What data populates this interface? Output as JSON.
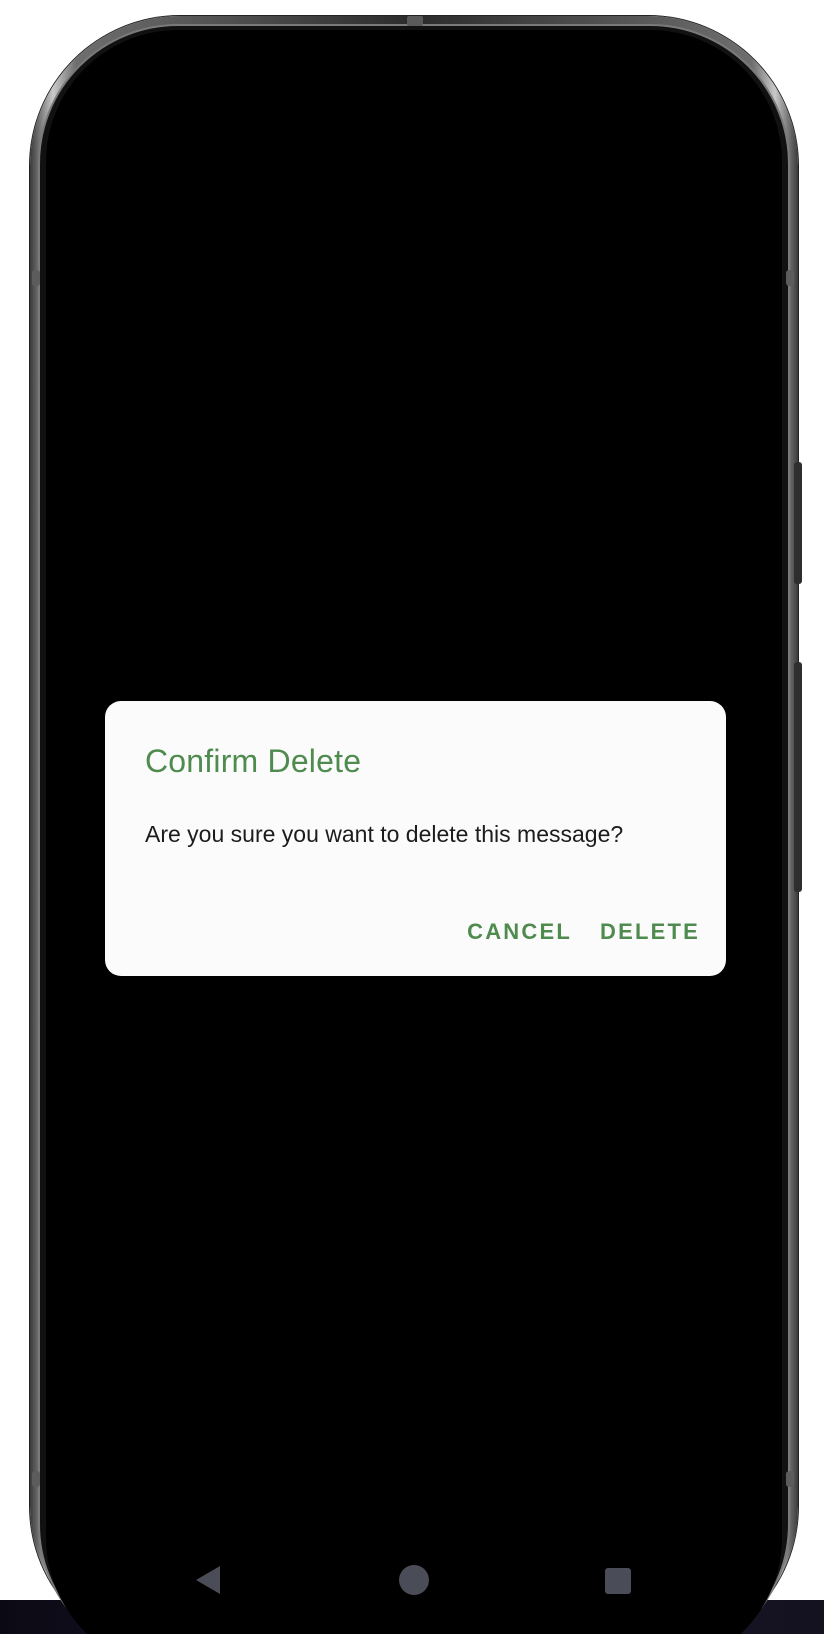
{
  "dialog": {
    "title": "Confirm Delete",
    "message": "Are you sure you want to delete this message?",
    "cancel_label": "CANCEL",
    "delete_label": "DELETE"
  },
  "colors": {
    "accent": "#4f8b4f",
    "dialog_background": "#fbfbfb",
    "screen_background": "#000000",
    "nav_icons": "#4a4d57"
  },
  "nav_bar": {
    "icons": [
      "back-icon",
      "home-icon",
      "recents-icon"
    ]
  }
}
